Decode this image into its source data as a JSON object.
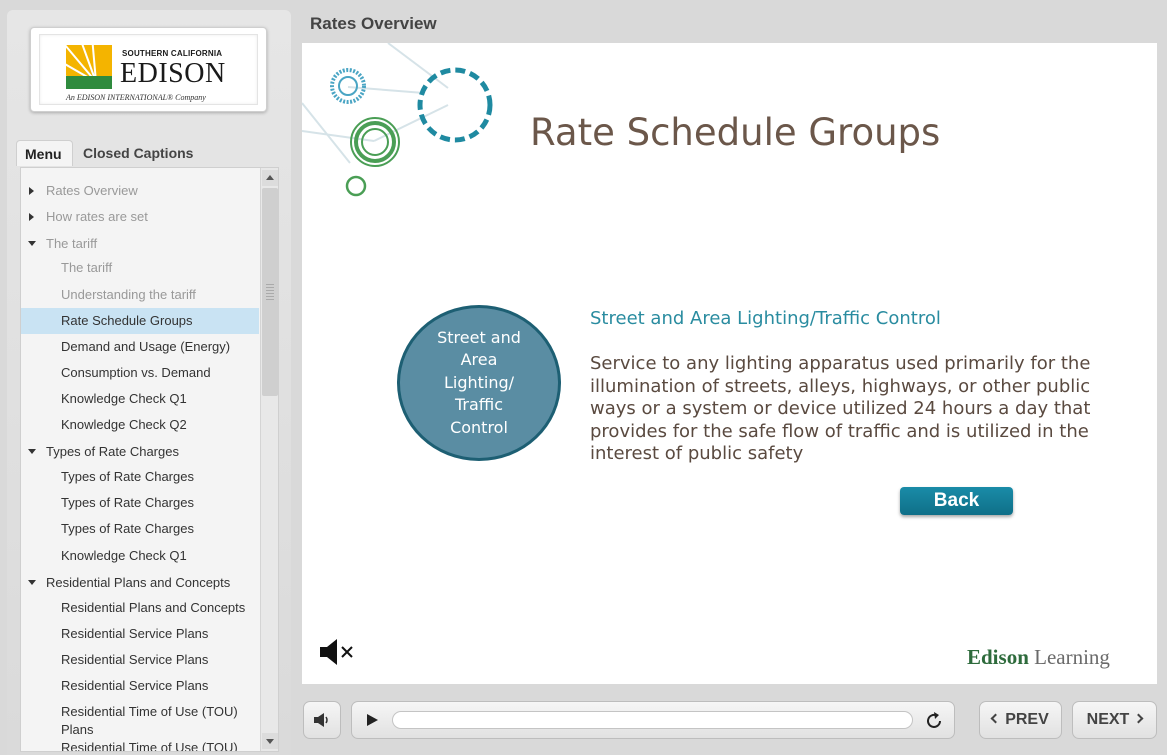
{
  "logo": {
    "top_line": "SOUTHERN CALIFORNIA",
    "name": "EDISON",
    "tagline": "An EDISON INTERNATIONAL® Company"
  },
  "sidebar": {
    "tabs": [
      {
        "label": "Menu",
        "active": true
      },
      {
        "label": "Closed Captions",
        "active": false
      }
    ],
    "items": [
      {
        "label": "Rates Overview",
        "level": 1,
        "arrow": "right",
        "dim": true
      },
      {
        "label": "How rates are set",
        "level": 1,
        "arrow": "right",
        "dim": true
      },
      {
        "label": "The tariff",
        "level": 1,
        "arrow": "down",
        "dim": true
      },
      {
        "label": "The tariff",
        "level": 2,
        "dim": true
      },
      {
        "label": "Understanding the tariff",
        "level": 2,
        "dim": true
      },
      {
        "label": "Rate Schedule Groups",
        "level": 2,
        "selected": true
      },
      {
        "label": "Demand and Usage (Energy)",
        "level": 2
      },
      {
        "label": "Consumption vs. Demand",
        "level": 2
      },
      {
        "label": "Knowledge Check Q1",
        "level": 2
      },
      {
        "label": "Knowledge Check Q2",
        "level": 2
      },
      {
        "label": "Types of Rate Charges",
        "level": 1,
        "arrow": "down"
      },
      {
        "label": "Types of Rate Charges",
        "level": 2
      },
      {
        "label": "Types of Rate Charges",
        "level": 2
      },
      {
        "label": "Types of Rate Charges",
        "level": 2
      },
      {
        "label": "Knowledge Check Q1",
        "level": 2
      },
      {
        "label": "Residential Plans and Concepts",
        "level": 1,
        "arrow": "down"
      },
      {
        "label": "Residential Plans and Concepts",
        "level": 2
      },
      {
        "label": "Residential Service Plans",
        "level": 2
      },
      {
        "label": "Residential Service Plans",
        "level": 2
      },
      {
        "label": "Residential Service Plans",
        "level": 2
      },
      {
        "label": "Residential Time of Use (TOU) Plans",
        "level": 2
      },
      {
        "label": "Residential Time of Use (TOU)",
        "level": 2
      }
    ]
  },
  "header": {
    "title": "Rates Overview"
  },
  "slide": {
    "title": "Rate Schedule Groups",
    "circle_label": "Street and\nArea\nLighting/\nTraffic\nControl",
    "subheading": "Street and Area Lighting/Traffic Control",
    "description": "Service to any lighting apparatus used primarily for the illumination of streets, alleys, highways, or other public ways or a system or device utilized 24 hours a day that provides for the safe flow of traffic and is utilized in the interest of public safety",
    "back_label": "Back",
    "brand_bold": "Edison",
    "brand_light": "Learning"
  },
  "controls": {
    "prev_label": "PREV",
    "next_label": "NEXT",
    "progress": 0
  },
  "colors": {
    "accent": "#1a8ca8",
    "circle_fill": "#5a8da3",
    "title_brown": "#6b574a",
    "selected_row": "#c9e3f3"
  }
}
